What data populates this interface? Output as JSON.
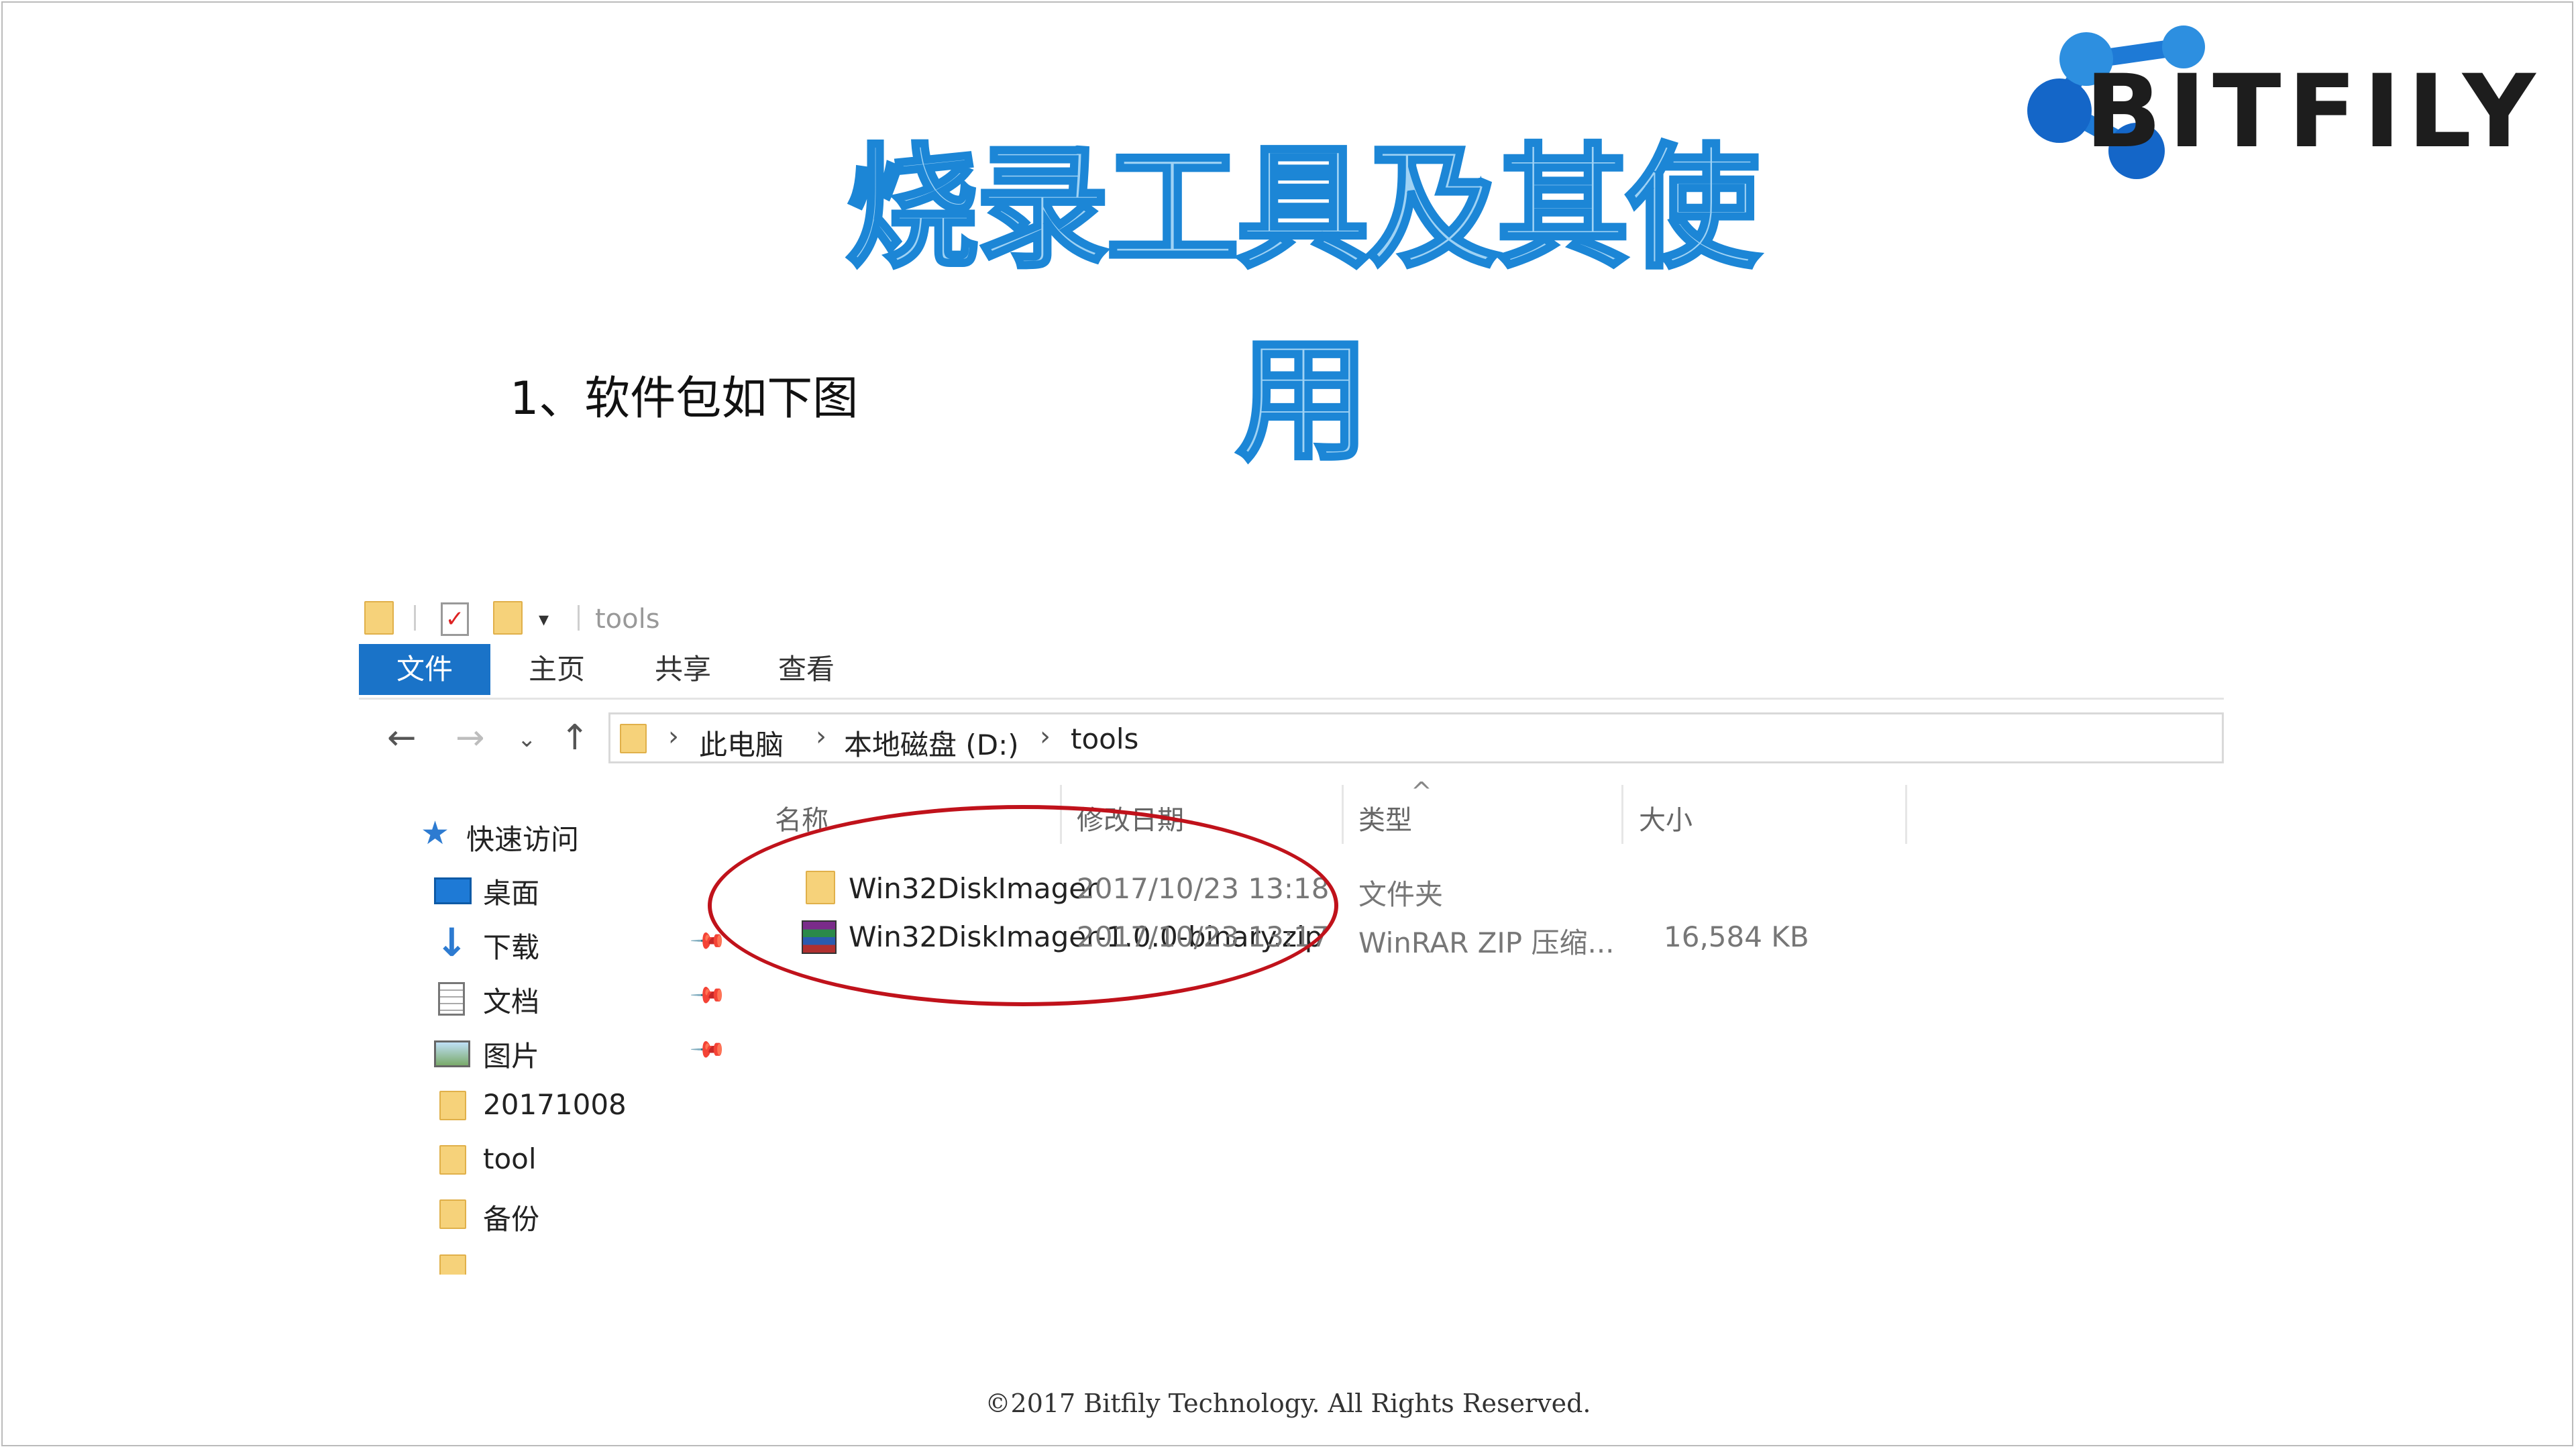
{
  "slide": {
    "title": "烧录工具及其使用",
    "subtitle": "1、软件包如下图",
    "footer": "©2017 Bitfily Technology. All Rights Reserved."
  },
  "logo": {
    "text": "BITFILY",
    "colors": {
      "accent": "#1e7ad6",
      "text": "#1d1d1d"
    }
  },
  "explorer": {
    "window_title": "tools",
    "ribbon_tabs": [
      {
        "label": "文件",
        "active": true
      },
      {
        "label": "主页",
        "active": false
      },
      {
        "label": "共享",
        "active": false
      },
      {
        "label": "查看",
        "active": false
      }
    ],
    "breadcrumb": [
      "此电脑",
      "本地磁盘 (D:)",
      "tools"
    ],
    "sidebar": [
      {
        "label": "快速访问",
        "icon": "star-icon",
        "pinned": false
      },
      {
        "label": "桌面",
        "icon": "desktop-icon",
        "pinned": true
      },
      {
        "label": "下载",
        "icon": "download-icon",
        "pinned": true
      },
      {
        "label": "文档",
        "icon": "document-icon",
        "pinned": true
      },
      {
        "label": "图片",
        "icon": "picture-icon",
        "pinned": true
      },
      {
        "label": "20171008",
        "icon": "folder-icon",
        "pinned": false
      },
      {
        "label": "tool",
        "icon": "folder-icon",
        "pinned": false
      },
      {
        "label": "备份",
        "icon": "folder-icon",
        "pinned": false
      }
    ],
    "columns": [
      "名称",
      "修改日期",
      "类型",
      "大小"
    ],
    "files": [
      {
        "name": "Win32DiskImager",
        "modified": "2017/10/23 13:18",
        "type": "文件夹",
        "size": "",
        "icon": "folder-icon"
      },
      {
        "name": "Win32DiskImager-1.0.0-binary.zip",
        "modified": "2017/10/23 13:17",
        "type": "WinRAR ZIP 压缩...",
        "size": "16,584 KB",
        "icon": "winrar-zip-icon"
      }
    ],
    "annotation_color": "#c0121b"
  }
}
